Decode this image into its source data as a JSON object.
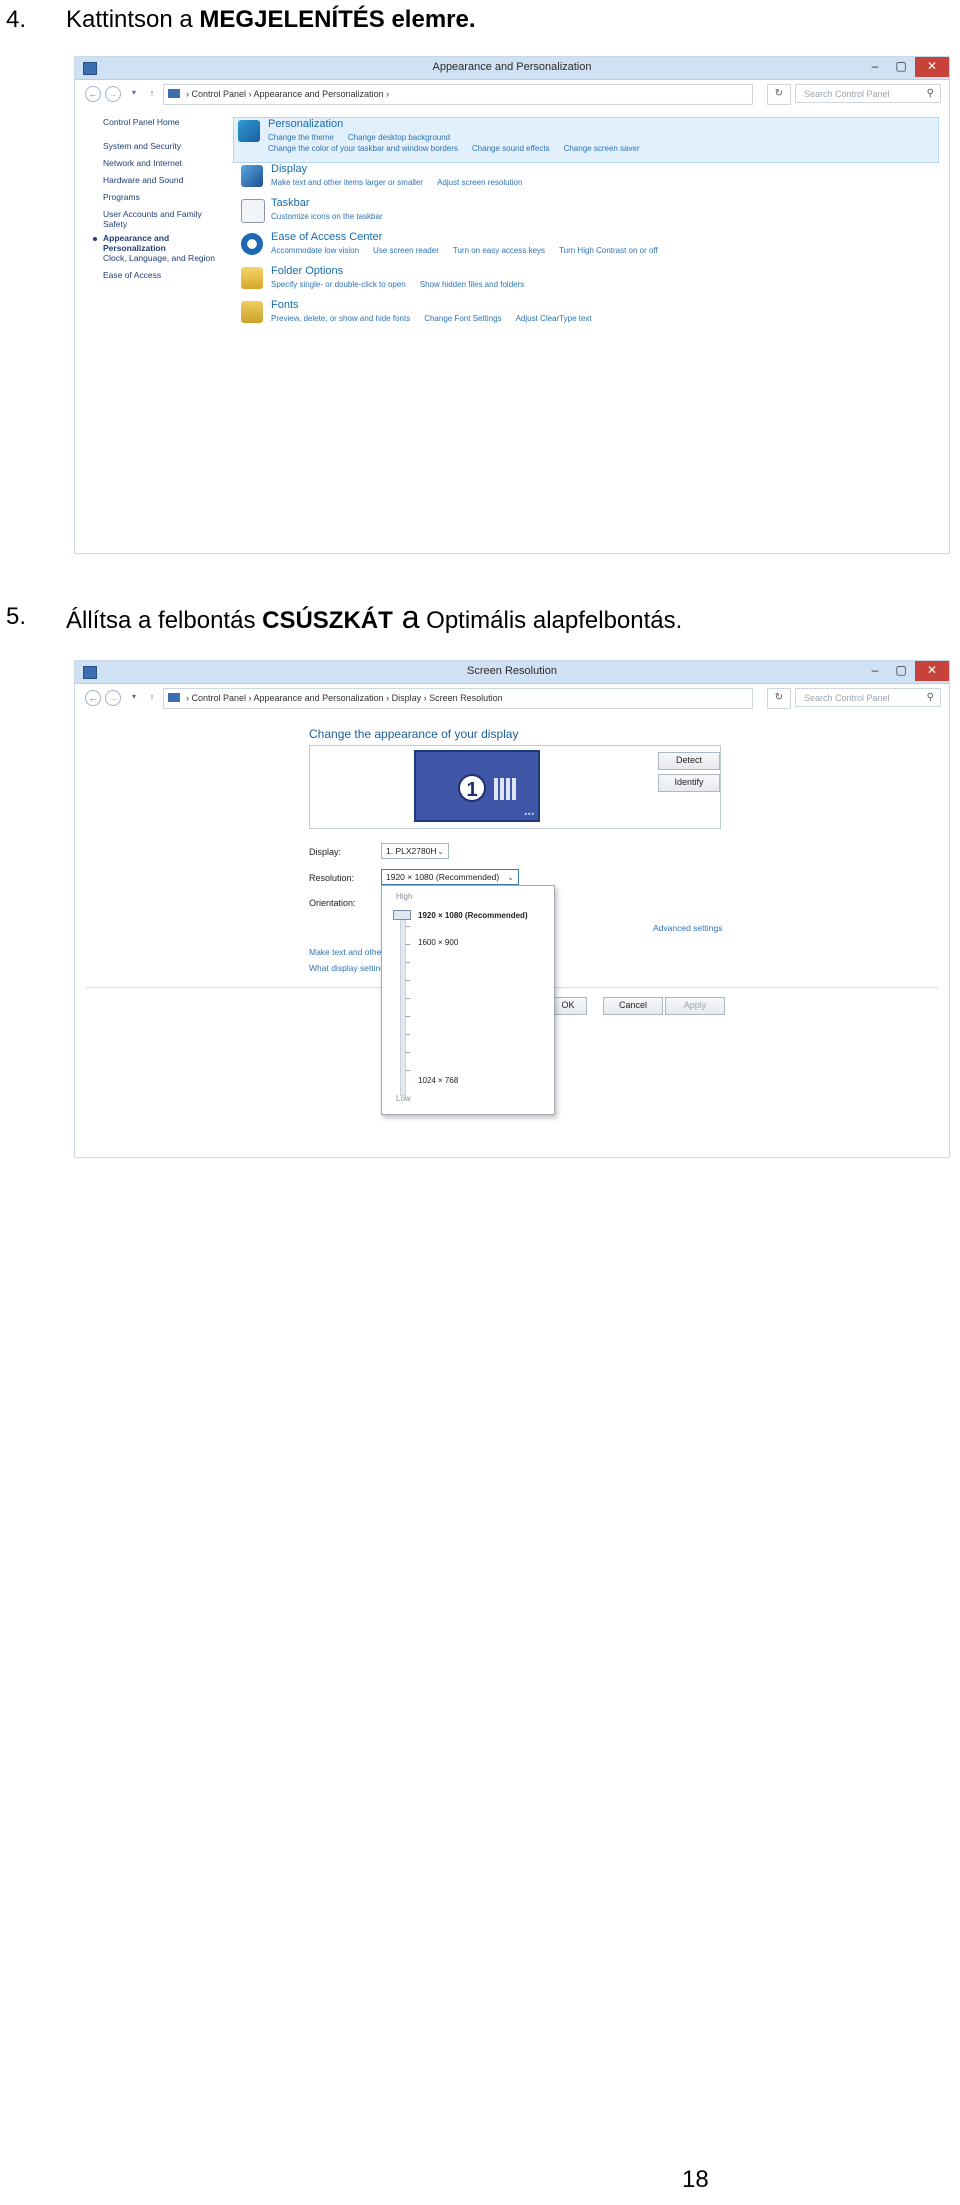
{
  "step4": {
    "number": "4.",
    "text": "Kattintson a ",
    "bold": "MEGJELENÍTÉS elemre."
  },
  "shot1": {
    "title": "Appearance and Personalization",
    "breadcrumb": "›  Control Panel  ›  Appearance and Personalization  ›",
    "search_placeholder": "Search Control Panel",
    "sidebar": [
      "Control Panel Home",
      "System and Security",
      "Network and Internet",
      "Hardware and Sound",
      "Programs",
      "User Accounts and Family Safety",
      "Appearance and Personalization",
      "Clock, Language, and Region",
      "Ease of Access"
    ],
    "categories": [
      {
        "name": "Personalization",
        "icon": "personalization-icon",
        "links": [
          "Change the theme",
          "Change desktop background"
        ],
        "links2": [
          "Change the color of your taskbar and window borders",
          "Change sound effects",
          "Change screen saver"
        ]
      },
      {
        "name": "Display",
        "icon": "display-icon",
        "links": [
          "Make text and other items larger or smaller",
          "Adjust screen resolution"
        ],
        "links2": []
      },
      {
        "name": "Taskbar",
        "icon": "taskbar-icon",
        "links": [
          "Customize icons on the taskbar"
        ],
        "links2": []
      },
      {
        "name": "Ease of Access Center",
        "icon": "ease-of-access-icon",
        "links": [
          "Accommodate low vision",
          "Use screen reader",
          "Turn on easy access keys",
          "Turn High Contrast on or off"
        ],
        "links2": []
      },
      {
        "name": "Folder Options",
        "icon": "folder-icon",
        "links": [
          "Specify single- or double-click to open",
          "Show hidden files and folders"
        ],
        "links2": []
      },
      {
        "name": "Fonts",
        "icon": "fonts-icon",
        "links": [
          "Preview, delete, or show and hide fonts",
          "Change Font Settings",
          "Adjust ClearType text"
        ],
        "links2": []
      }
    ]
  },
  "step5": {
    "number": "5.",
    "text1": "Állítsa a felbontás ",
    "bold": "CSÚSZKÁT",
    "big": " a",
    "text2": " Optimális alapfelbontás."
  },
  "shot2": {
    "title": "Screen Resolution",
    "breadcrumb": "›  Control Panel  ›  Appearance and Personalization  ›  Display  ›  Screen Resolution",
    "search_placeholder": "Search Control Panel",
    "heading": "Change the appearance of your display",
    "monitor_number": "1",
    "detect": "Detect",
    "identify": "Identify",
    "display_label": "Display:",
    "display_value": "1. PLX2780H",
    "resolution_label": "Resolution:",
    "resolution_value": "1920 × 1080 (Recommended)",
    "orientation_label": "Orientation:",
    "advanced": "Advanced settings",
    "link1": "Make text and other",
    "link2": "What display setting",
    "ok": "OK",
    "cancel": "Cancel",
    "apply": "Apply",
    "popup": {
      "high": "High",
      "low": "Low",
      "opt1": "1920 × 1080 (Recommended)",
      "opt2": "1600 × 900",
      "opt3": "1024 × 768",
      "slider_position": 1.0
    }
  },
  "page_number": "18"
}
